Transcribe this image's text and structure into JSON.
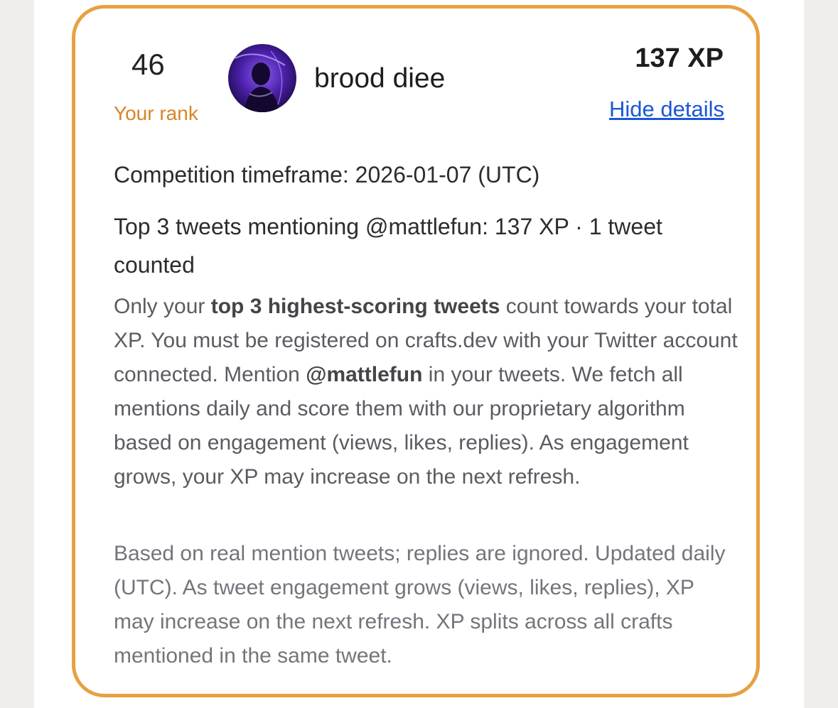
{
  "rank": {
    "value": "46",
    "label": "Your rank"
  },
  "user": {
    "name": "brood diee",
    "avatar_icon": "avatar-icon"
  },
  "xp": {
    "total": "137 XP",
    "toggle_label": "Hide details"
  },
  "details": {
    "timeframe": "Competition timeframe: 2026-01-07 (UTC)",
    "top_tweets": "Top 3 tweets mentioning @mattlefun: 137 XP · 1 tweet counted",
    "desc_p1": "Only your ",
    "desc_b1": "top 3 highest-scoring tweets",
    "desc_p2": " count towards your total XP. You must be registered on crafts.dev with your Twitter account connected. Mention ",
    "desc_b2": "@mattlefun",
    "desc_p3": " in your tweets. We fetch all mentions daily and score them with our proprietary algorithm based on engagement (views, likes, replies). As engagement grows, your XP may increase on the next refresh.",
    "note": "Based on real mention tweets; replies are ignored. Updated daily (UTC). As tweet engagement grows (views, likes, replies), XP may increase on the next refresh. XP splits across all crafts mentioned in the same tweet."
  },
  "colors": {
    "card_border": "#e8a040",
    "rank_label": "#d88528",
    "link": "#1a57d6"
  }
}
